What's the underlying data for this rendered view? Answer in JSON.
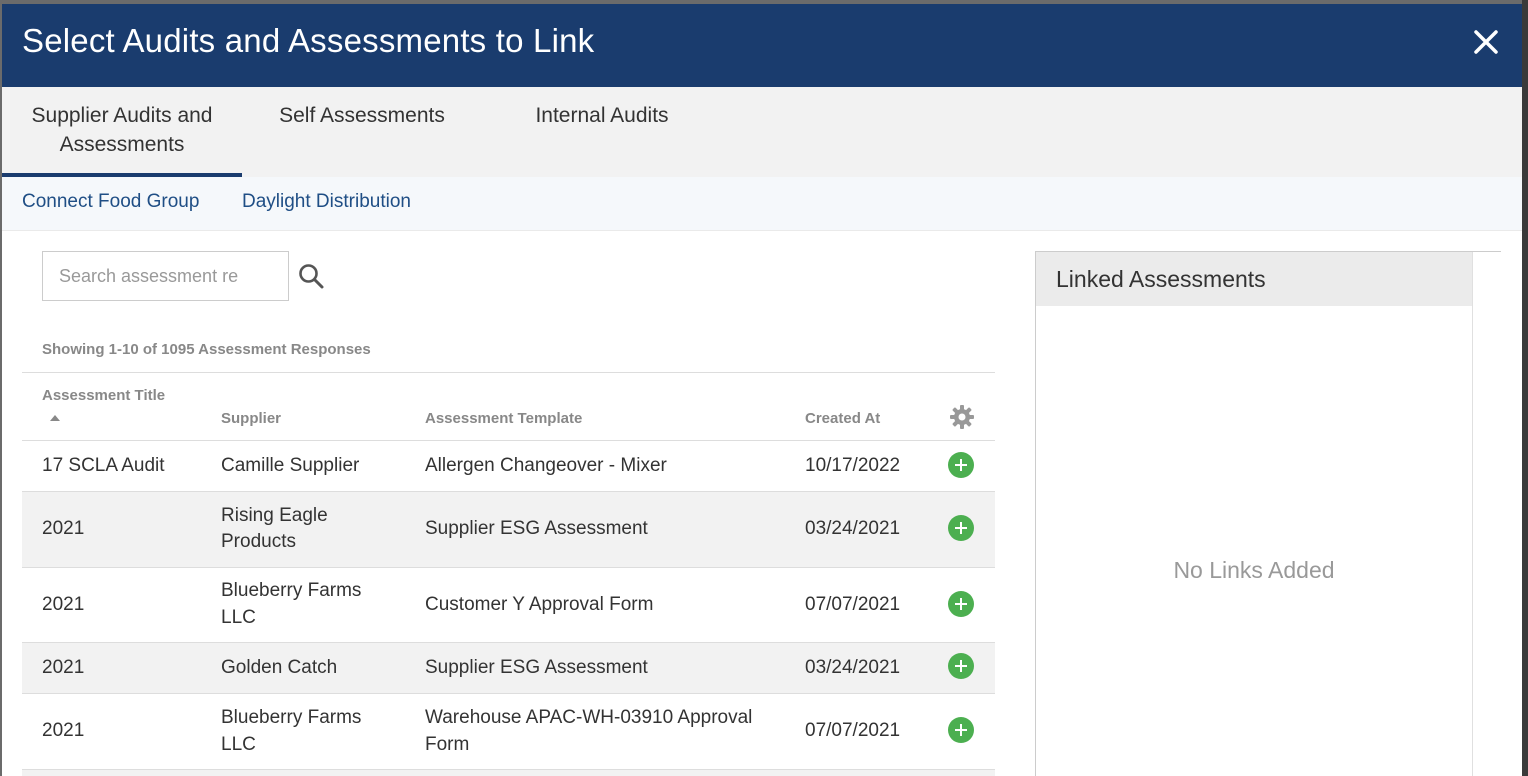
{
  "modal": {
    "title": "Select Audits and Assessments to Link"
  },
  "tabs": [
    {
      "label_line1": "Supplier Audits and",
      "label_line2": "Assessments"
    },
    {
      "label": "Self Assessments"
    },
    {
      "label": "Internal Audits"
    }
  ],
  "subnav": [
    {
      "label": "Connect Food Group"
    },
    {
      "label": "Daylight Distribution"
    }
  ],
  "search": {
    "placeholder": "Search assessment re",
    "value": ""
  },
  "results": {
    "showing": "Showing 1-10 of 1095 Assessment Responses"
  },
  "table": {
    "headers": {
      "title": "Assessment Title",
      "supplier": "Supplier",
      "template": "Assessment Template",
      "created": "Created At"
    },
    "rows": [
      {
        "title": "17 SCLA Audit",
        "supplier": "Camille Supplier",
        "supplier2": "",
        "template": "Allergen Changeover - Mixer",
        "template2": "",
        "created": "10/17/2022"
      },
      {
        "title": "2021",
        "supplier": "Rising Eagle",
        "supplier2": "Products",
        "template": "Supplier ESG Assessment",
        "template2": "",
        "created": "03/24/2021"
      },
      {
        "title": "2021",
        "supplier": "Blueberry Farms",
        "supplier2": "LLC",
        "template": "Customer Y Approval Form",
        "template2": "",
        "created": "07/07/2021"
      },
      {
        "title": "2021",
        "supplier": "Golden Catch",
        "supplier2": "",
        "template": "Supplier ESG Assessment",
        "template2": "",
        "created": "03/24/2021"
      },
      {
        "title": "2021",
        "supplier": "Blueberry Farms",
        "supplier2": "LLC",
        "template": "Warehouse APAC-WH-03910 Approval",
        "template2": "Form",
        "created": "07/07/2021"
      }
    ]
  },
  "linked": {
    "title": "Linked Assessments",
    "empty": "No Links Added"
  },
  "colors": {
    "header_bg": "#1a3c6e",
    "add_green": "#4caf50",
    "link_blue": "#1f4e85"
  }
}
